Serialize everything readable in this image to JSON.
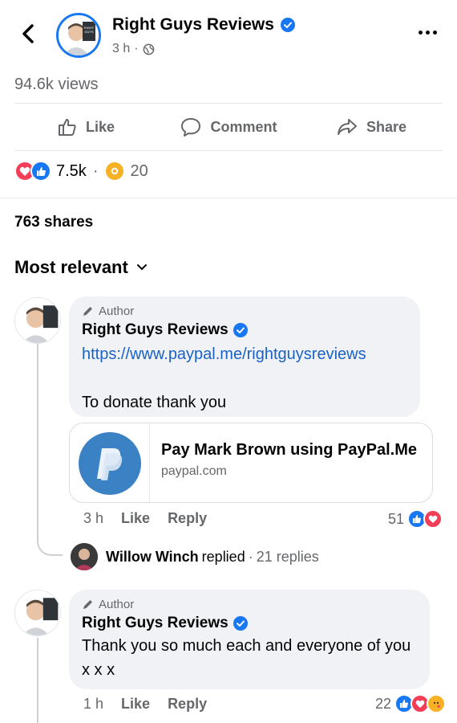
{
  "header": {
    "page_name": "Right Guys Reviews",
    "time": "3 h",
    "dot": "·"
  },
  "post": {
    "views": "94.6k views",
    "actions": {
      "like": "Like",
      "comment": "Comment",
      "share": "Share"
    },
    "reaction_count": "7.5k",
    "separator": "·",
    "care_count": "20",
    "shares": "763 shares"
  },
  "sort": {
    "label": "Most relevant"
  },
  "comments": [
    {
      "author_tag": "Author",
      "name": "Right Guys Reviews",
      "link": "https://www.paypal.me/rightguysreviews",
      "text": "To donate thank you",
      "link_card": {
        "title": "Pay Mark Brown using PayPal.Me",
        "domain": "paypal.com"
      },
      "time": "3 h",
      "like": "Like",
      "reply": "Reply",
      "reaction_count": "51",
      "replies": {
        "name": "Willow Winch",
        "replied": "replied",
        "dot": "·",
        "count": "21 replies"
      }
    },
    {
      "author_tag": "Author",
      "name": "Right Guys Reviews",
      "text": "Thank you so much each and everyone of you x x x",
      "time": "1 h",
      "like": "Like",
      "reply": "Reply",
      "reaction_count": "22"
    }
  ],
  "colors": {
    "accent": "#1877f2",
    "love": "#f33e58",
    "care": "#f7b125",
    "paypal": "#3b82c4"
  },
  "icons": {
    "back": "chevron-left-icon",
    "more": "more-dots-icon",
    "globe": "globe-icon",
    "verified": "verified-badge-icon",
    "like": "thumbs-up-icon",
    "comment": "speech-bubble-icon",
    "share": "share-arrow-icon",
    "pencil": "pencil-icon"
  }
}
